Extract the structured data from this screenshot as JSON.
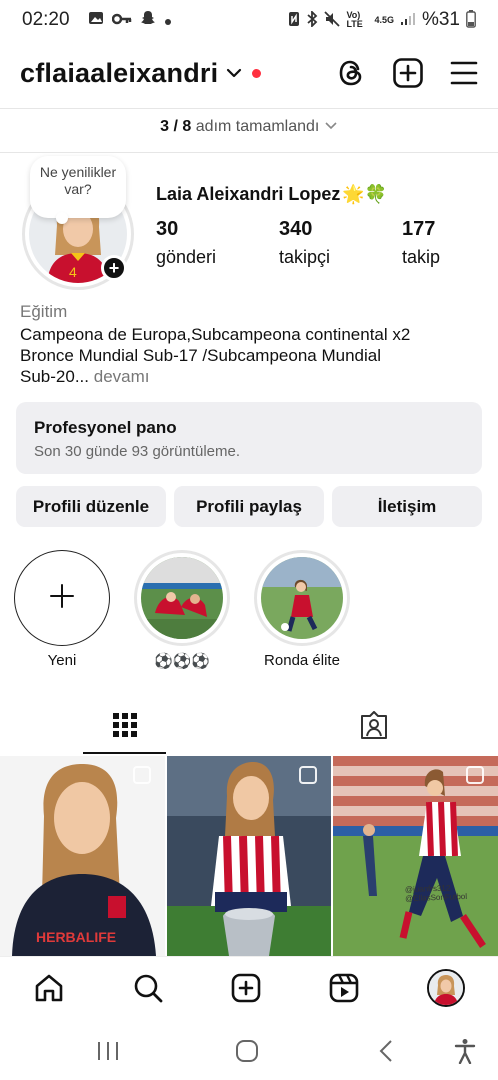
{
  "status_bar": {
    "time": "02:20",
    "network_label": "Vo) LTE",
    "signal_label": "4.5G",
    "battery": "%31"
  },
  "header": {
    "username": "cflaiaaleixandri"
  },
  "progress": {
    "count": "3 / 8",
    "text": "adım tamamlandı"
  },
  "note": {
    "text": "Ne yenilikler var?"
  },
  "profile": {
    "full_name": "Laia Aleixandri Lopez",
    "full_name_emojis": "🌟🍀",
    "stats": [
      {
        "value": "30",
        "label": "gönderi"
      },
      {
        "value": "340",
        "label": "takipçi"
      },
      {
        "value": "177",
        "label": "takip"
      }
    ],
    "category": "Eğitim",
    "bio_line1": "Campeona de Europa,Subcampeona continental x2",
    "bio_line2": "Bronce Mundial Sub-17 /Subcampeona Mundial",
    "bio_line3": "Sub-20...",
    "bio_more": "devamı"
  },
  "dashboard": {
    "title": "Profesyonel pano",
    "subtitle": "Son 30 günde 93 görüntüleme."
  },
  "buttons": {
    "edit": "Profili düzenle",
    "share": "Profili paylaş",
    "contact": "İletişim"
  },
  "highlights": [
    {
      "label": "Yeni"
    },
    {
      "label": "⚽⚽⚽"
    },
    {
      "label": "Ronda élite"
    }
  ],
  "grid": {
    "post3_caption": "@juanfrs312\n@EllasSonFutbol"
  },
  "colors": {
    "accent_red": "#ff3040",
    "button_bg": "#efeff2",
    "muted_text": "#777777"
  }
}
